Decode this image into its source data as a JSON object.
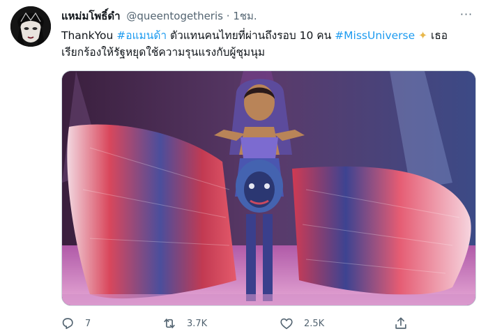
{
  "tweet": {
    "display_name": "แหม่มโพธิ์ดำ",
    "handle": "@queentogetheris",
    "separator": "·",
    "time": "1ชม.",
    "more_label": "···",
    "text": {
      "part1": "ThankYou ",
      "hashtag1": "#อแมนด้า",
      "part2": " ตัวแทนคนไทยที่ผ่านถึงรอบ 10 คน ",
      "hashtag2": "#MissUniverse",
      "sparkle": "✦",
      "part3": " เธอเรียกร้องให้รัฐหยุดใช้ความรุนแรงกับผู้ชุมนุม"
    },
    "media_icon": "photo-contestant-fish-costume",
    "actions": {
      "reply": {
        "icon": "reply-icon",
        "count": "7"
      },
      "retweet": {
        "icon": "retweet-icon",
        "count": "3.7K"
      },
      "like": {
        "icon": "heart-icon",
        "count": "2.5K"
      },
      "share": {
        "icon": "share-icon"
      }
    },
    "colors": {
      "link": "#1d9bf0",
      "secondary_text": "#536471",
      "primary_text": "#0f1419",
      "border": "#cfd9de"
    }
  }
}
